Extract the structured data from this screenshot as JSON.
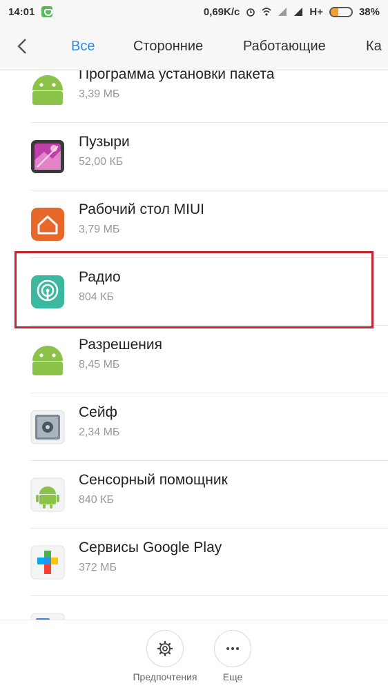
{
  "status_bar": {
    "time": "14:01",
    "network_speed": "0,69K/c",
    "network_type": "H+",
    "battery_percent": "38%",
    "battery_level": 0.38
  },
  "tabs": {
    "back_icon": "chevron-left-icon",
    "items": [
      {
        "label": "Все",
        "active": true
      },
      {
        "label": "Сторонние",
        "active": false
      },
      {
        "label": "Работающие",
        "active": false
      },
      {
        "label": "Ка",
        "active": false
      }
    ]
  },
  "apps": [
    {
      "name": "Программа установки пакета",
      "size": "3,39 МБ",
      "icon": "android-icon"
    },
    {
      "name": "Пузыри",
      "size": "52,00 КБ",
      "icon": "bubbles-wallpaper-icon"
    },
    {
      "name": "Рабочий стол MIUI",
      "size": "3,79 МБ",
      "icon": "home-icon"
    },
    {
      "name": "Радио",
      "size": "804 КБ",
      "icon": "radio-icon"
    },
    {
      "name": "Разрешения",
      "size": "8,45 МБ",
      "icon": "android-icon"
    },
    {
      "name": "Сейф",
      "size": "2,34 МБ",
      "icon": "safe-icon"
    },
    {
      "name": "Сенсорный помощник",
      "size": "840 КБ",
      "icon": "android-small-icon"
    },
    {
      "name": "Сервисы Google Play",
      "size": "372 МБ",
      "icon": "google-play-services-icon"
    }
  ],
  "bottom_bar": {
    "preferences_label": "Предпочтения",
    "more_label": "Еще"
  },
  "colors": {
    "accent": "#2a8ee8",
    "highlight": "#c8202a",
    "android_green": "#8bc34a",
    "home_orange": "#e8672a",
    "radio_teal": "#3cb8a0"
  }
}
